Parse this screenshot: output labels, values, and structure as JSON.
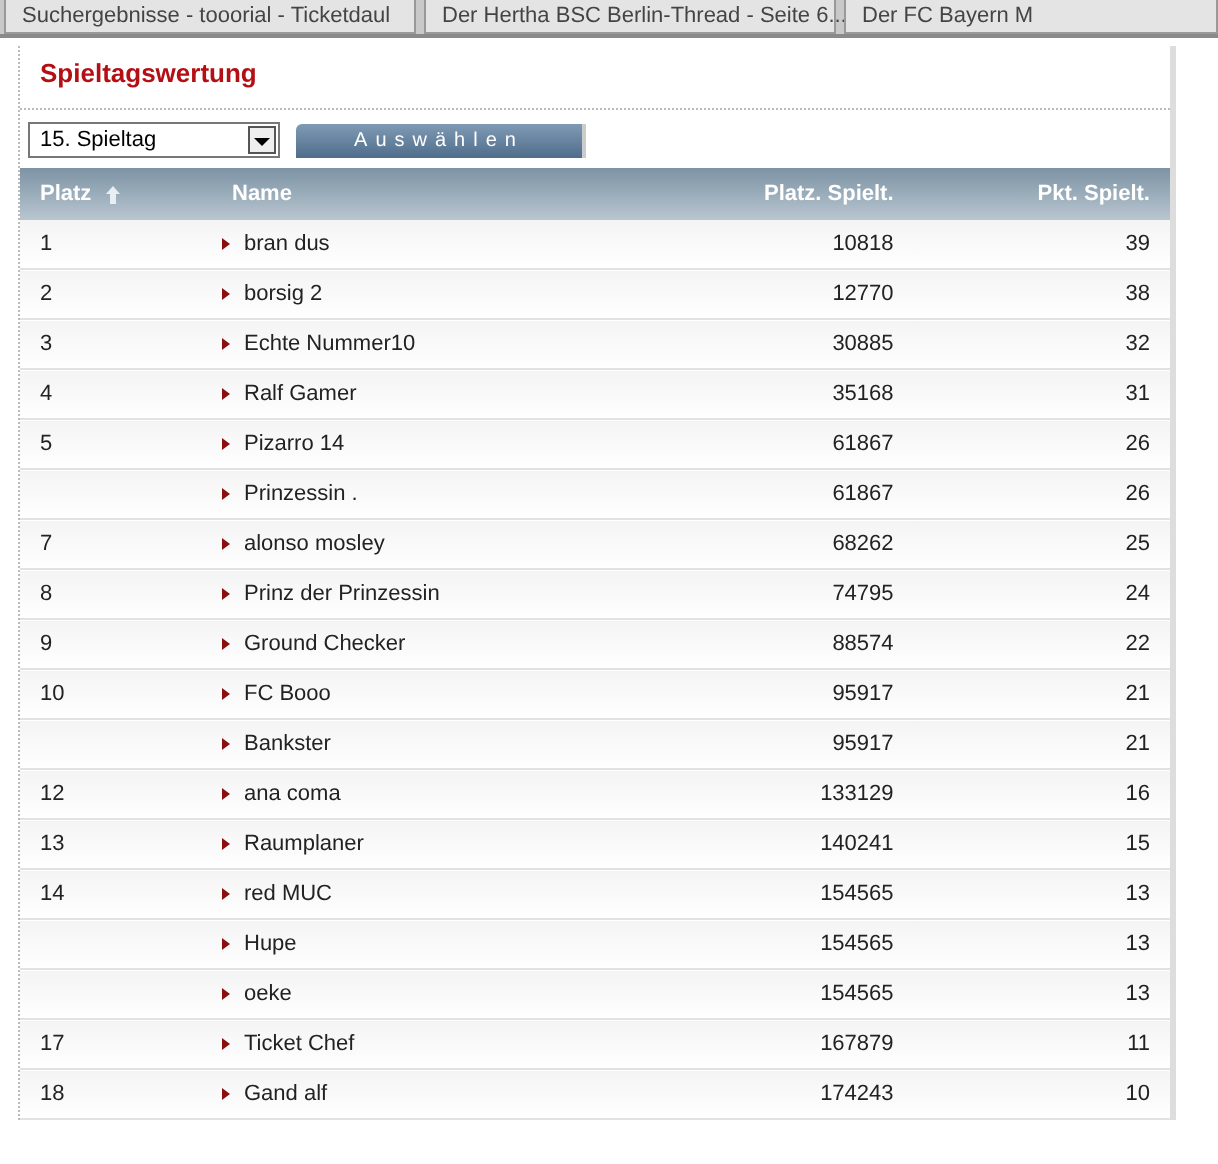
{
  "browser_tabs": [
    {
      "label": "Suchergebnisse - tooorial - Ticketdaul"
    },
    {
      "label": "Der Hertha BSC Berlin-Thread - Seite 6..."
    },
    {
      "label": "Der FC Bayern M"
    }
  ],
  "title": "Spieltagswertung",
  "matchday_select": {
    "value": "15. Spieltag"
  },
  "select_button": "Auswählen",
  "table": {
    "columns": [
      {
        "label": "Platz",
        "sorted": true
      },
      {
        "label": "Name",
        "sorted": false
      },
      {
        "label": "Platz. Spielt.",
        "sorted": false
      },
      {
        "label": "Pkt. Spielt.",
        "sorted": false
      }
    ],
    "rows": [
      {
        "platz": "1",
        "name": "bran dus",
        "platz_spielt": "10818",
        "pkt_spielt": "39"
      },
      {
        "platz": "2",
        "name": "borsig 2",
        "platz_spielt": "12770",
        "pkt_spielt": "38"
      },
      {
        "platz": "3",
        "name": "Echte Nummer10",
        "platz_spielt": "30885",
        "pkt_spielt": "32"
      },
      {
        "platz": "4",
        "name": "Ralf Gamer",
        "platz_spielt": "35168",
        "pkt_spielt": "31"
      },
      {
        "platz": "5",
        "name": "Pizarro 14",
        "platz_spielt": "61867",
        "pkt_spielt": "26"
      },
      {
        "platz": "",
        "name": "Prinzessin .",
        "platz_spielt": "61867",
        "pkt_spielt": "26"
      },
      {
        "platz": "7",
        "name": "alonso mosley",
        "platz_spielt": "68262",
        "pkt_spielt": "25"
      },
      {
        "platz": "8",
        "name": "Prinz der Prinzessin",
        "platz_spielt": "74795",
        "pkt_spielt": "24"
      },
      {
        "platz": "9",
        "name": "Ground Checker",
        "platz_spielt": "88574",
        "pkt_spielt": "22"
      },
      {
        "platz": "10",
        "name": "FC Booo",
        "platz_spielt": "95917",
        "pkt_spielt": "21"
      },
      {
        "platz": "",
        "name": "Bankster",
        "platz_spielt": "95917",
        "pkt_spielt": "21"
      },
      {
        "platz": "12",
        "name": "ana coma",
        "platz_spielt": "133129",
        "pkt_spielt": "16"
      },
      {
        "platz": "13",
        "name": "Raumplaner",
        "platz_spielt": "140241",
        "pkt_spielt": "15"
      },
      {
        "platz": "14",
        "name": "red MUC",
        "platz_spielt": "154565",
        "pkt_spielt": "13"
      },
      {
        "platz": "",
        "name": "Hupe",
        "platz_spielt": "154565",
        "pkt_spielt": "13"
      },
      {
        "platz": "",
        "name": "oeke",
        "platz_spielt": "154565",
        "pkt_spielt": "13"
      },
      {
        "platz": "17",
        "name": "Ticket Chef",
        "platz_spielt": "167879",
        "pkt_spielt": "11"
      },
      {
        "platz": "18",
        "name": "Gand alf",
        "platz_spielt": "174243",
        "pkt_spielt": "10"
      }
    ]
  }
}
